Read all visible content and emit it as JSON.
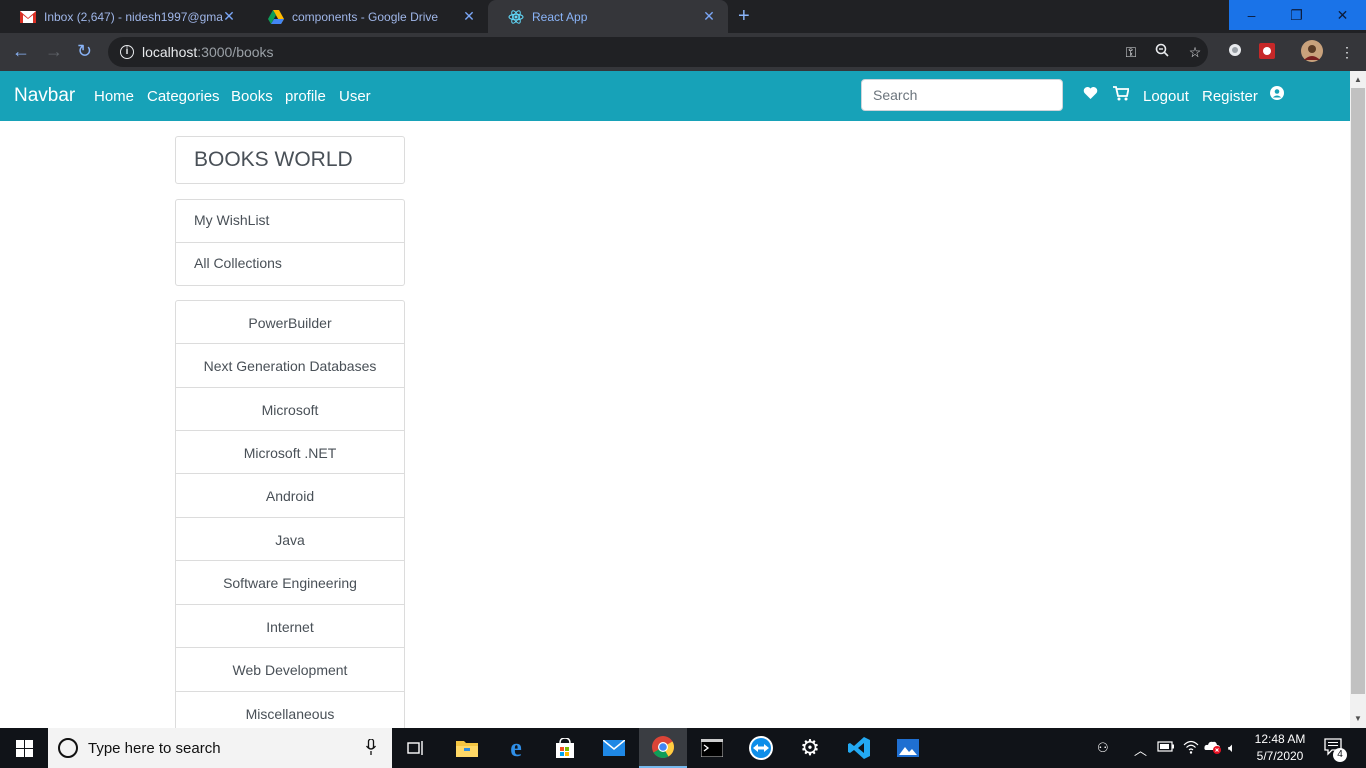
{
  "browser": {
    "tabs": [
      {
        "title": "Inbox (2,647) - nidesh1997@gma",
        "icon": "gmail-icon"
      },
      {
        "title": "components - Google Drive",
        "icon": "google-drive-icon"
      },
      {
        "title": "React App",
        "icon": "react-icon",
        "active": true
      }
    ],
    "new_tab": "+",
    "window_controls": {
      "minimize": "–",
      "restore": "❐",
      "close": "✕"
    },
    "url_host": "localhost",
    "url_path": ":3000/books"
  },
  "navbar": {
    "brand": "Navbar",
    "links": [
      "Home",
      "Categories",
      "Books",
      "profile",
      "User"
    ],
    "search_placeholder": "Search",
    "logout": "Logout",
    "register": "Register",
    "bg_color": "#17a2b8"
  },
  "sidebar": {
    "title": "BOOKS WORLD",
    "menu": [
      "My WishList",
      "All Collections"
    ],
    "categories": [
      "PowerBuilder",
      "Next Generation Databases",
      "Microsoft",
      "Microsoft .NET",
      "Android",
      "Java",
      "Software Engineering",
      "Internet",
      "Web Development",
      "Miscellaneous"
    ]
  },
  "taskbar": {
    "search_text": "Type here to search",
    "time": "12:48 AM",
    "date": "5/7/2020",
    "notifications": "4"
  }
}
